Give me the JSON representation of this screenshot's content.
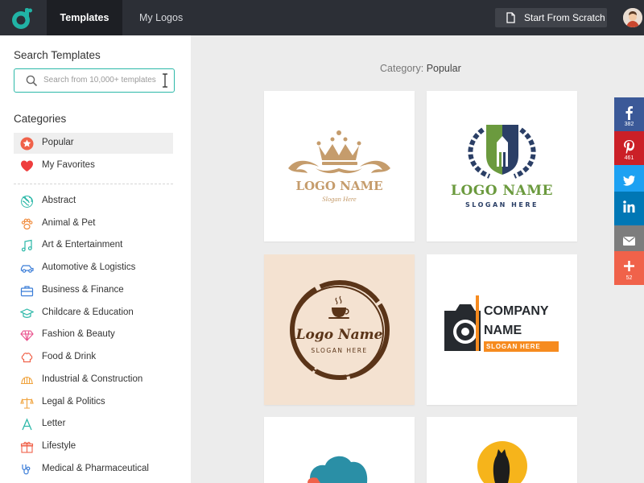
{
  "nav": {
    "tabs": [
      "Templates",
      "My Logos"
    ],
    "scratch_label": "Start From Scratch"
  },
  "sidebar": {
    "search_heading": "Search Templates",
    "search_placeholder": "Search from 10,000+ templates",
    "categories_heading": "Categories",
    "pinned": [
      {
        "label": "Popular",
        "icon": "star-icon"
      },
      {
        "label": "My Favorites",
        "icon": "heart-icon"
      }
    ],
    "categories": [
      {
        "label": "Abstract",
        "icon": "abstract-icon"
      },
      {
        "label": "Animal & Pet",
        "icon": "paw-icon"
      },
      {
        "label": "Art & Entertainment",
        "icon": "music-note-icon"
      },
      {
        "label": "Automotive & Logistics",
        "icon": "car-icon"
      },
      {
        "label": "Business & Finance",
        "icon": "briefcase-icon"
      },
      {
        "label": "Childcare & Education",
        "icon": "graduation-cap-icon"
      },
      {
        "label": "Fashion & Beauty",
        "icon": "diamond-icon"
      },
      {
        "label": "Food & Drink",
        "icon": "chef-hat-icon"
      },
      {
        "label": "Industrial & Construction",
        "icon": "hard-hat-icon"
      },
      {
        "label": "Legal & Politics",
        "icon": "scales-icon"
      },
      {
        "label": "Letter",
        "icon": "letter-a-icon"
      },
      {
        "label": "Lifestyle",
        "icon": "gift-icon"
      },
      {
        "label": "Medical & Pharmaceutical",
        "icon": "stethoscope-icon"
      }
    ]
  },
  "main": {
    "category_prefix": "Category:",
    "category_name": "Popular",
    "templates": [
      {
        "name": "LOGO NAME",
        "slogan": "Slogan Here"
      },
      {
        "name": "LOGO NAME",
        "slogan": "SLOGAN HERE"
      },
      {
        "name": "Logo Name",
        "slogan": "SLOGAN HERE"
      },
      {
        "name_line1": "COMPANY",
        "name_line2": "NAME",
        "slogan": "SLOGAN HERE"
      }
    ]
  },
  "share": [
    {
      "network": "facebook",
      "count": "382",
      "color": "#3b5998"
    },
    {
      "network": "pinterest",
      "count": "461",
      "color": "#cb2027"
    },
    {
      "network": "twitter",
      "count": "",
      "color": "#1da1f2"
    },
    {
      "network": "linkedin",
      "count": "",
      "color": "#0077b5"
    },
    {
      "network": "email",
      "count": "",
      "color": "#7d7d7d"
    },
    {
      "network": "more",
      "count": "52",
      "color": "#f0624a"
    }
  ],
  "colors": {
    "topbar": "#2c2f36",
    "accent": "#2cb8a8",
    "popular": "#f0624a"
  }
}
